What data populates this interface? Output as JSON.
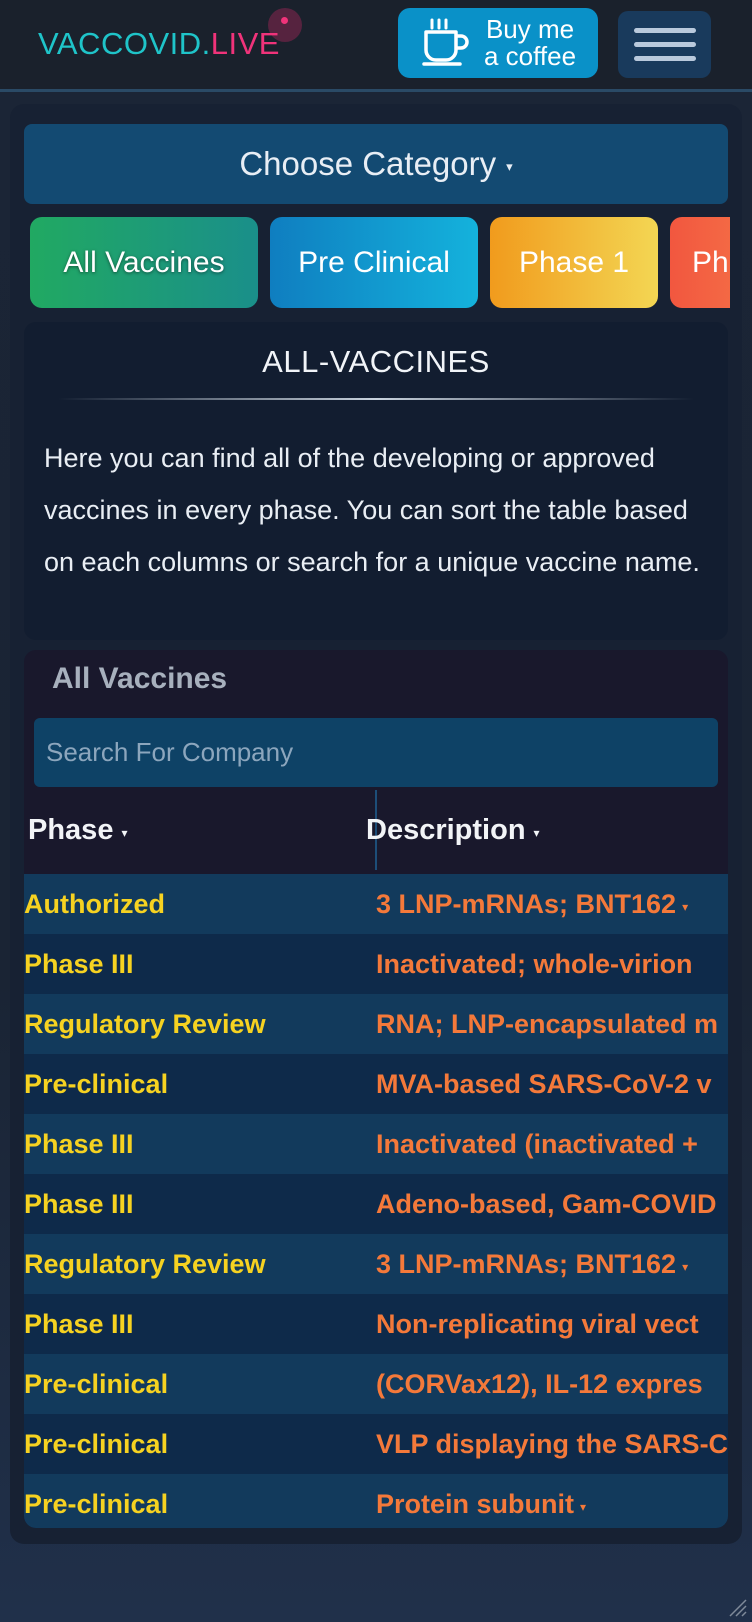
{
  "header": {
    "logo_part1": "VACCOVID.",
    "logo_part2": "LIVE",
    "coffee_line1": "Buy me",
    "coffee_line2": "a coffee",
    "coffee_icon": "coffee-cup-icon",
    "menu_icon": "hamburger-icon"
  },
  "category": {
    "label": "Choose Category",
    "caret": "▾"
  },
  "pills": [
    {
      "label": "All Vaccines"
    },
    {
      "label": "Pre Clinical"
    },
    {
      "label": "Phase 1"
    },
    {
      "label": "Ph"
    }
  ],
  "info": {
    "title": "ALL-VACCINES",
    "text": "Here you can find all of the developing or approved vaccines in every phase. You can sort the table based on each columns or search for a unique vaccine name."
  },
  "table": {
    "title": "All Vaccines",
    "search_placeholder": "Search For Company",
    "columns": [
      "Phase",
      "Description"
    ],
    "sort_caret": "▾",
    "rows": [
      {
        "phase": "Authorized",
        "desc": "3 LNP-mRNAs; BNT162",
        "dd": "▾"
      },
      {
        "phase": "Phase III",
        "desc": "Inactivated; whole-virion",
        "dd": ""
      },
      {
        "phase": "Regulatory Review",
        "desc": "RNA; LNP-encapsulated m",
        "dd": ""
      },
      {
        "phase": "Pre-clinical",
        "desc": "MVA-based SARS-CoV-2 v",
        "dd": ""
      },
      {
        "phase": "Phase III",
        "desc": "Inactivated (inactivated +",
        "dd": ""
      },
      {
        "phase": "Phase III",
        "desc": "Adeno-based, Gam-COVID",
        "dd": ""
      },
      {
        "phase": "Regulatory Review",
        "desc": "3 LNP-mRNAs; BNT162",
        "dd": "▾"
      },
      {
        "phase": "Phase III",
        "desc": "Non-replicating viral vect",
        "dd": ""
      },
      {
        "phase": "Pre-clinical",
        "desc": "(CORVax12), IL-12 expres",
        "dd": ""
      },
      {
        "phase": "Pre-clinical",
        "desc": "VLP displaying the SARS-C",
        "dd": ""
      },
      {
        "phase": "Pre-clinical",
        "desc": "Protein subunit",
        "dd": "▾"
      }
    ]
  },
  "colors": {
    "logo_teal": "#1fc4c9",
    "logo_pink": "#f0337a",
    "phase_yellow": "#f6d221",
    "desc_orange": "#f4793a",
    "coffee_blue": "#0a91c8"
  }
}
